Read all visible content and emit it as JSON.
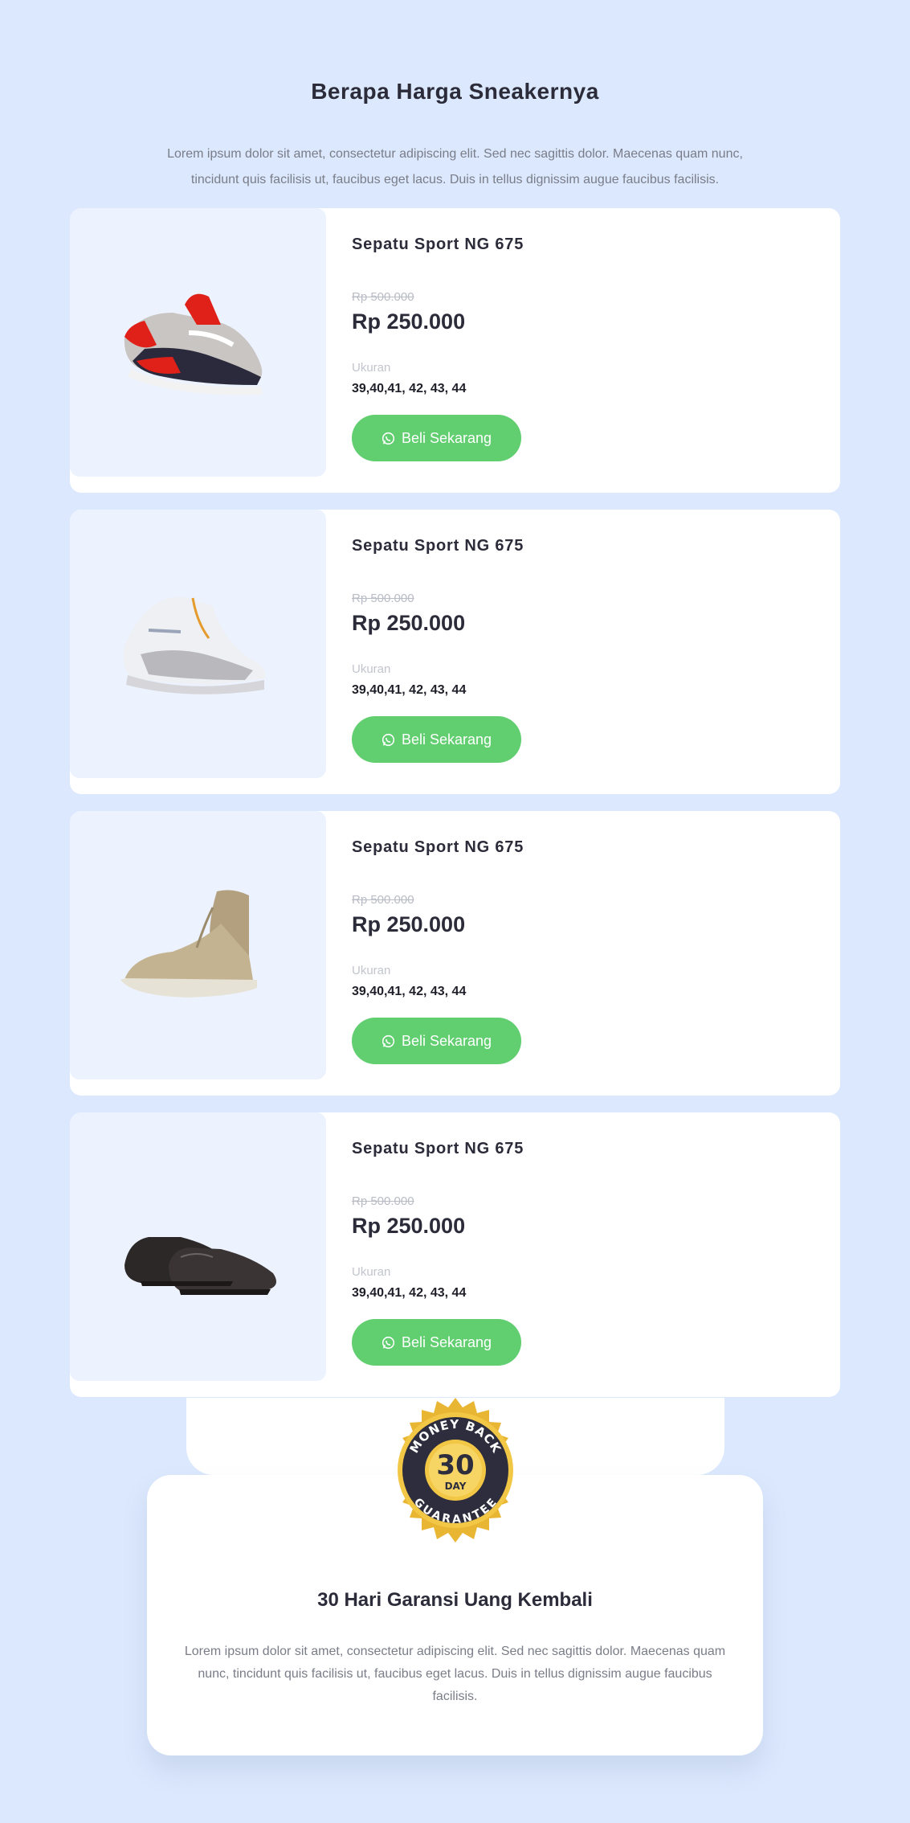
{
  "section": {
    "title": "Berapa Harga Sneakernya",
    "description": "Lorem ipsum dolor sit amet, consectetur adipiscing elit. Sed nec sagittis dolor. Maecenas quam nunc, tincidunt quis facilisis ut, faucibus eget lacus. Duis in tellus dignissim augue faucibus facilisis."
  },
  "products": [
    {
      "name": "Sepatu Sport NG 675",
      "old_price": "Rp 500.000",
      "price": "Rp 250.000",
      "size_label": "Ukuran",
      "sizes": "39,40,41, 42, 43, 44",
      "button": "Beli Sekarang",
      "image_icon": "red-sneaker-image"
    },
    {
      "name": "Sepatu Sport NG 675",
      "old_price": "Rp 500.000",
      "price": "Rp 250.000",
      "size_label": "Ukuran",
      "sizes": "39,40,41, 42, 43, 44",
      "button": "Beli Sekarang",
      "image_icon": "white-sneaker-image"
    },
    {
      "name": "Sepatu Sport NG 675",
      "old_price": "Rp 500.000",
      "price": "Rp 250.000",
      "size_label": "Ukuran",
      "sizes": "39,40,41, 42, 43, 44",
      "button": "Beli Sekarang",
      "image_icon": "tan-boot-image"
    },
    {
      "name": "Sepatu Sport NG 675",
      "old_price": "Rp 500.000",
      "price": "Rp 250.000",
      "size_label": "Ukuran",
      "sizes": "39,40,41, 42, 43, 44",
      "button": "Beli Sekarang",
      "image_icon": "leather-shoes-image"
    }
  ],
  "guarantee": {
    "badge_top": "MONEY BACK",
    "badge_number": "30",
    "badge_unit": "DAY",
    "badge_bottom": "GUARANTEE",
    "title": "30 Hari Garansi Uang Kembali",
    "description": "Lorem ipsum dolor sit amet, consectetur adipiscing elit. Sed nec sagittis dolor. Maecenas quam nunc, tincidunt quis facilisis ut, faucibus eget lacus. Duis in tellus dignissim augue faucibus facilisis."
  },
  "colors": {
    "background": "#dbe8fd",
    "button": "#61ce70",
    "badge_gold": "#f0c23e",
    "badge_dark": "#2d2d3d"
  }
}
